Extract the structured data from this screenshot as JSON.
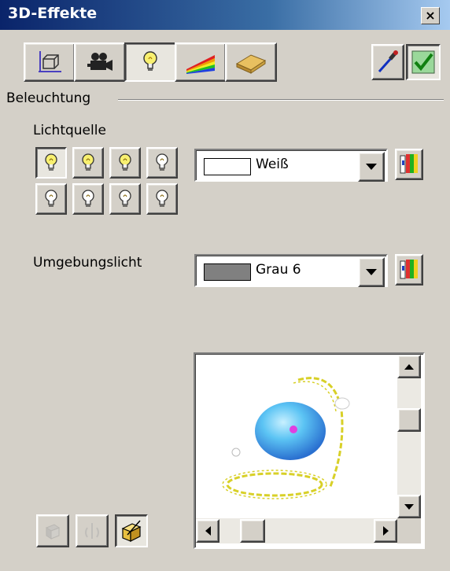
{
  "window": {
    "title": "3D-Effekte",
    "close_symbol": "×"
  },
  "toolbar": {
    "tabs": [
      {
        "name": "geometry-tab",
        "icon": "cube-geometry-icon",
        "pressed": false
      },
      {
        "name": "shading-tab",
        "icon": "camera-icon",
        "pressed": false
      },
      {
        "name": "illumination-tab",
        "icon": "lightbulb-icon",
        "pressed": true
      },
      {
        "name": "textures-tab",
        "icon": "rainbow-texture-icon",
        "pressed": false
      },
      {
        "name": "material-tab",
        "icon": "material-bar-icon",
        "pressed": false
      }
    ],
    "assign_icon": "pipette-icon",
    "apply_icon": "checkmark-icon"
  },
  "illumination": {
    "group_label": "Beleuchtung",
    "light_source_label": "Lichtquelle",
    "light_source_color": {
      "value": "Weiß",
      "swatch": "#ffffff"
    },
    "ambient_label": "Umgebungslicht",
    "ambient_color": {
      "value": "Grau 6",
      "swatch": "#808080"
    },
    "lights_on": [
      true,
      true,
      true,
      false,
      false,
      false,
      false,
      false
    ],
    "light_selected": 0
  },
  "colors": {
    "titlebar": "#0a246a",
    "face": "#d4d0c8",
    "sphere": "#4fb8f0",
    "light_ring": "#d8d028"
  }
}
